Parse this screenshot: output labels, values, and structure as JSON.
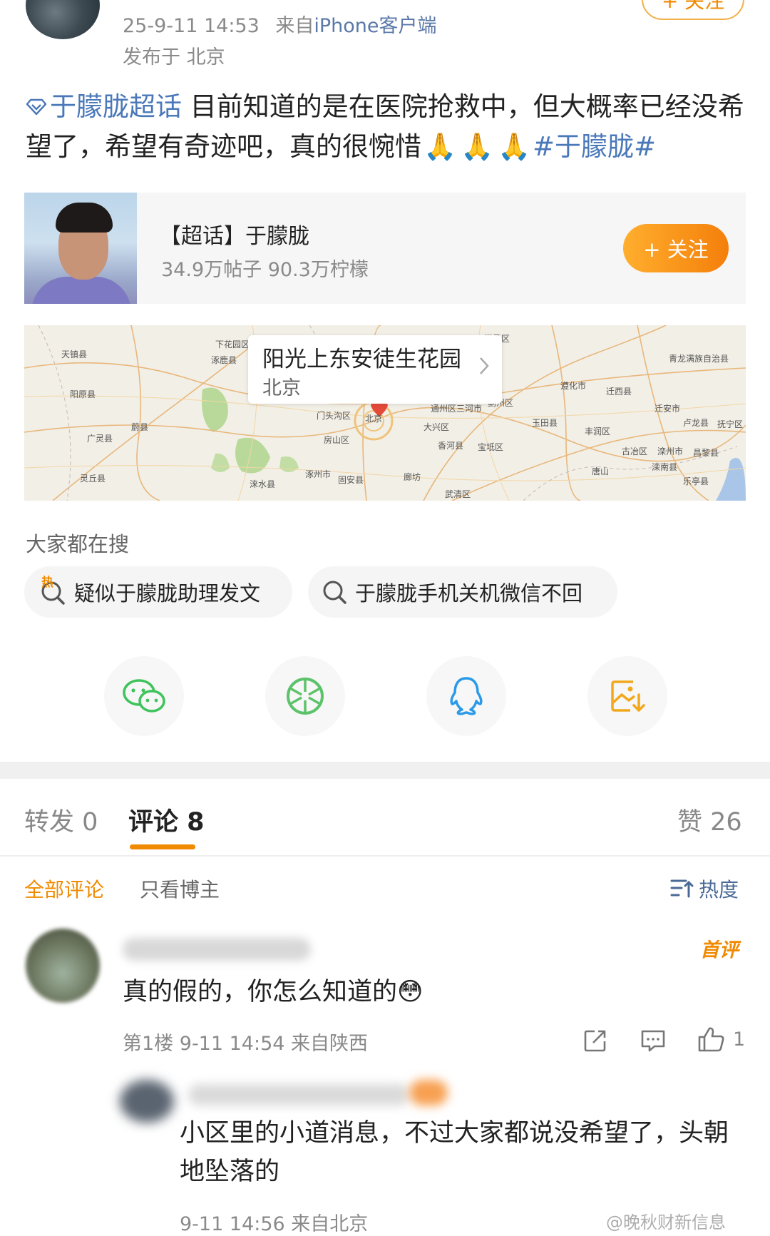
{
  "header": {
    "timestamp": "25-9-11 14:53",
    "source_prefix": "来自",
    "source": "iPhone客户端",
    "location": "发布于 北京",
    "follow_label": "+ 关注"
  },
  "post": {
    "topic": "于朦胧超话",
    "text": " 目前知道的是在医院抢救中，但大概率已经没希望了，希望有奇迹吧，真的很惋惜",
    "emoji": [
      "🙏",
      "🙏",
      "🙏"
    ],
    "hashtag": "#于朦胧#"
  },
  "super_topic_card": {
    "title": "【超话】于朦胧",
    "stats": "34.9万帖子 90.3万柠檬",
    "follow_label": "+ 关注"
  },
  "map": {
    "place_name": "阳光上东安徒生花园",
    "city": "北京",
    "places": [
      "北京",
      "怀柔区",
      "下花园区",
      "涿鹿县",
      "天镇县",
      "阳原县",
      "蔚县",
      "广灵县",
      "灵丘县",
      "门头沟区",
      "房山区",
      "涞水县",
      "涿州市",
      "大兴区",
      "通州区",
      "三河市",
      "香河县",
      "廊坊",
      "固安县",
      "宝坻区",
      "玉田县",
      "丰润区",
      "唐山",
      "迁西县",
      "青龙满族自治县",
      "迁安市",
      "卢龙县",
      "抚宁区",
      "昌黎县",
      "滦南县",
      "乐亭县",
      "遵化市",
      "蓟州区",
      "古冶区",
      "滦州市",
      "武清区"
    ]
  },
  "search": {
    "title": "大家都在搜",
    "chips": [
      {
        "label": "疑似于朦胧助理发文",
        "icon": "hot-search-icon",
        "badge": "热"
      },
      {
        "label": "于朦胧手机关机微信不回",
        "icon": "search-icon"
      }
    ]
  },
  "share": {
    "items": [
      {
        "icon": "wechat-icon",
        "color": "#3fc35c"
      },
      {
        "icon": "moments-icon",
        "color": "#5cc36a"
      },
      {
        "icon": "qq-icon",
        "color": "#2a9ae8"
      },
      {
        "icon": "save-image-icon",
        "color": "#f2a81d"
      }
    ]
  },
  "tabs": {
    "repost": "转发 0",
    "comments": "评论 8",
    "likes": "赞 26"
  },
  "filters": {
    "all": "全部评论",
    "author_only": "只看博主",
    "sort": "热度"
  },
  "comment": {
    "badge": "首评",
    "text": "真的假的，你怎么知道的",
    "emoji": "😳",
    "meta": "第1楼 9-11 14:54 来自陕西",
    "like_count": "1"
  },
  "reply": {
    "text": "小区里的小道消息，不过大家都说没希望了，头朝地坠落的",
    "meta": "9-11 14:56 来自北京",
    "watermark": "@晚秋财新信息"
  },
  "colors": {
    "accent_orange": "#f08a00",
    "topic_blue": "#4a78b8",
    "muted_gray": "#8a8a8a"
  }
}
